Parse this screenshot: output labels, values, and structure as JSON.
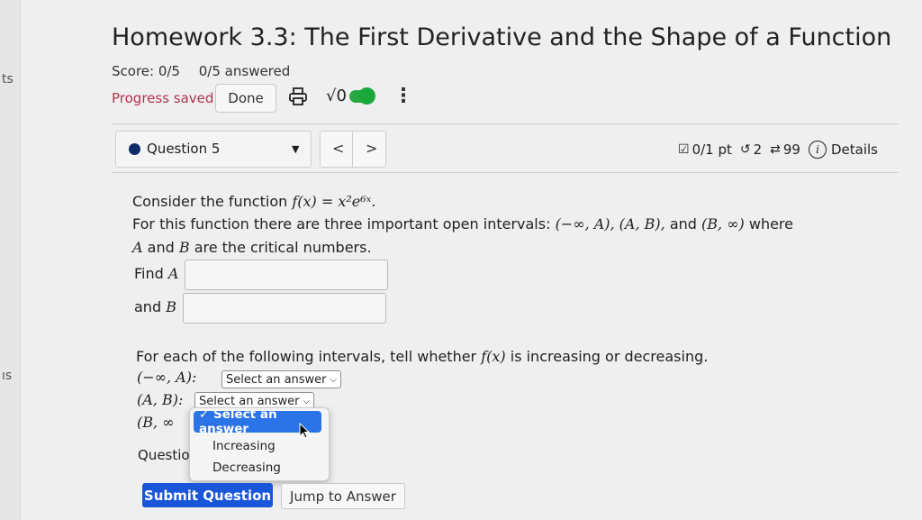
{
  "edge": {
    "top_text": "ts",
    "bottom_text": "ıs"
  },
  "header": {
    "title": "Homework 3.3: The First Derivative and the Shape of a Function",
    "score": "Score: 0/5",
    "answered": "0/5 answered",
    "progress": "Progress saved",
    "done_label": "Done",
    "sqrt_symbol": "√0",
    "menu_glyph": "⋮"
  },
  "question_nav": {
    "question_label": "Question 5",
    "prev": "<",
    "next": ">",
    "points": "0/1 pt",
    "retries": "2",
    "attempts": "99",
    "details": "Details"
  },
  "problem": {
    "line1_text": "Consider the function ",
    "line1_math": "f(x) = x²e⁶ˣ.",
    "line2_text": "For this function there are three important open intervals: ",
    "line2_math": "(−∞, A), (A, B),",
    "line2_and": " and ",
    "line2_math2": "(B, ∞)",
    "line2_where": " where",
    "line3_a": "A",
    "line3_and": " and ",
    "line3_b": "B",
    "line3_rest": " are the critical numbers.",
    "find_a_text": "Find ",
    "find_a_var": "A",
    "and_b_text": "and ",
    "and_b_var": "B"
  },
  "intervals": {
    "prompt_text": "For each of the following intervals, tell whether ",
    "prompt_math": "f(x)",
    "prompt_end": " is increasing or decreasing.",
    "interval1": "(−∞, A):",
    "interval2": "(A, B):",
    "interval3": "(B, ∞",
    "select1": "Select an answer",
    "select2": "Select an answer"
  },
  "dropdown": {
    "options": [
      "✓ Select an answer",
      "Increasing",
      "Decreasing"
    ]
  },
  "footer": {
    "question_help_truncated": "Questio",
    "submit": "Submit Question",
    "jump": "Jump to Answer"
  },
  "colors": {
    "submit_bg": "#1a56d9",
    "progress_saved": "#b1334f",
    "toggle": "#28a745",
    "dropdown_selected": "#2b74e8"
  }
}
